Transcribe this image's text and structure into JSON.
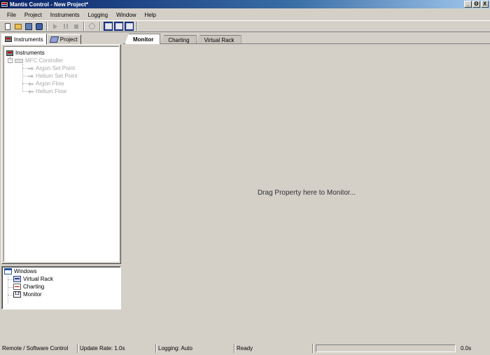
{
  "window": {
    "title": "Mantis Control - New Project*",
    "buttons": [
      "_",
      "Θ",
      "X"
    ]
  },
  "menu": [
    "File",
    "Project",
    "Instruments",
    "Logging",
    "Window",
    "Help"
  ],
  "toolbar": {
    "icons": [
      "new-document-icon",
      "open-folder-icon",
      "save-icon",
      "save-all-icon",
      "play-icon",
      "pause-icon",
      "stop-icon",
      "clear-icon",
      "view-stacked-icon",
      "view-tiled-icon",
      "view-monitor-icon"
    ]
  },
  "left_tabs": {
    "instruments": "Instruments",
    "project": "Project"
  },
  "tree": {
    "root": "Instruments",
    "controller": "MFC Controller",
    "properties": [
      "Argon Set Point",
      "Helium Set Point",
      "Argon Flow",
      "Helium Flow"
    ]
  },
  "windows": {
    "root": "Windows",
    "items": [
      "Virtual Rack",
      "Charting",
      "Monitor"
    ],
    "monitor_icon_text": "1.2"
  },
  "main_tabs": [
    "Monitor",
    "Charting",
    "Virtual Rack"
  ],
  "main": {
    "drop_hint": "Drag Property here to Monitor..."
  },
  "status": {
    "mode": "Remote / Software Control",
    "update_rate": "Update Rate: 1.0s",
    "logging": "Logging: Auto",
    "state": "Ready",
    "elapsed": "0.0s"
  }
}
